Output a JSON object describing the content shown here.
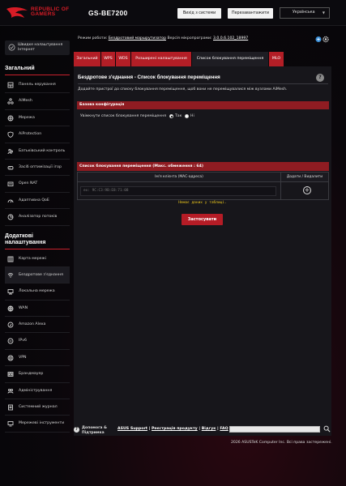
{
  "header": {
    "brand_line1": "REPUBLIC OF",
    "brand_line2": "GAMERS",
    "model": "GS-BE7200",
    "logout_label": "Вихід з системи",
    "reboot_label": "Перезавантажити",
    "language": "Українська"
  },
  "sidebar": {
    "wizard_label_line1": "Швидке налаштування",
    "wizard_label_line2": "Інтернет",
    "general_title": "Загальний",
    "general_items": [
      {
        "label": "Панель керування",
        "icon": "dashboard-icon"
      },
      {
        "label": "AiMesh",
        "icon": "aimesh-icon"
      },
      {
        "label": "Мережа",
        "icon": "network-icon"
      },
      {
        "label": "AiProtection",
        "icon": "aiprotection-icon"
      },
      {
        "label": "Батьківський контроль",
        "icon": "parental-control-icon"
      },
      {
        "label": "Засіб оптимізації ігор",
        "icon": "game-boost-icon"
      },
      {
        "label": "Open NAT",
        "icon": "open-nat-icon"
      },
      {
        "label": "Адаптивна QoE",
        "icon": "qos-icon"
      },
      {
        "label": "Аналізатор потоків",
        "icon": "traffic-analyzer-icon"
      }
    ],
    "advanced_title_line1": "Додаткові",
    "advanced_title_line2": "налаштування",
    "advanced_items": [
      {
        "label": "Карта мережі",
        "icon": "network-map-icon"
      },
      {
        "label": "Бездротове з'єднання",
        "icon": "wireless-icon"
      },
      {
        "label": "Локальна мережа",
        "icon": "lan-icon"
      },
      {
        "label": "WAN",
        "icon": "wan-icon"
      },
      {
        "label": "Amazon Alexa",
        "icon": "alexa-icon"
      },
      {
        "label": "IPv6",
        "icon": "ipv6-icon"
      },
      {
        "label": "VPN",
        "icon": "vpn-icon"
      },
      {
        "label": "Брандмауер",
        "icon": "firewall-icon"
      },
      {
        "label": "Адміністрування",
        "icon": "administration-icon"
      },
      {
        "label": "Системний журнал",
        "icon": "system-log-icon"
      },
      {
        "label": "Мережеві інструменти",
        "icon": "network-tools-icon"
      }
    ]
  },
  "main": {
    "opmode_prefix": "Режим роботи:",
    "opmode_value": "Бездротовий маршрутизатор",
    "firmware_prefix": "Версія мікропрограми:",
    "firmware_value": "3.0.0.6.102_18997",
    "tabs": [
      "Загальний",
      "WPS",
      "WDS",
      "Розширені налаштування",
      "Список блокування переміщення",
      "MLO"
    ],
    "active_tab": 4,
    "panel_title": "Бездротове з'єднання - Список блокування переміщення",
    "description": "Додайте пристрої до списку блокування переміщення, щоб вони не переміщувалися між вузлами AiMesh.",
    "basic_config_header": "Базова конфігурація",
    "enable_label": "Увімкнути список блокування переміщення",
    "radio_yes": "Так",
    "radio_no": "Ні",
    "enabled": true,
    "list_header": "Список блокування переміщення (Макс. обмеження : 64)",
    "col_client": "Ім'я клієнта (МАС-адреса)",
    "col_actions": "Додати / Видалити",
    "mac_placeholder": "ex: 9C:C3:9B:E8:71:08",
    "no_data": "Немає даних у таблиці.",
    "apply_label": "Застосувати"
  },
  "footer": {
    "help_line1": "Допомога &",
    "help_line2": "Підтримка",
    "link_support": "ASUS Support",
    "link_register": "Реєстрація продукту",
    "link_feedback": "Відгук",
    "link_faq": "FAQ",
    "separator": " | ",
    "copyright": "2026 ASUSTeK Computer Inc. Всі права застережені."
  },
  "colors": {
    "accent": "#b31e26",
    "bar": "#8f1c22",
    "panel": "#17161b",
    "no_data": "#e6c21c"
  }
}
